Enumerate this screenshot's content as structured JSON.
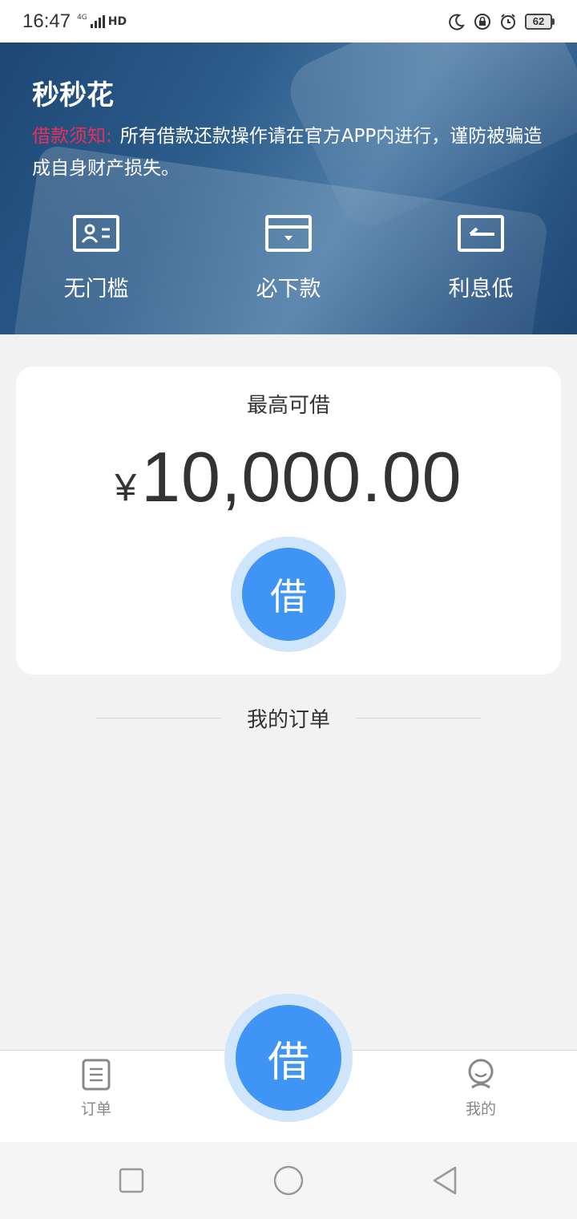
{
  "status_bar": {
    "time": "16:47",
    "network": "4G",
    "hd": "HD",
    "battery": "62"
  },
  "banner": {
    "app_title": "秒秒花",
    "notice_label": "借款须知:",
    "notice_text": "所有借款还款操作请在官方APP内进行，谨防被骗造成自身财产损失。",
    "features": [
      {
        "icon": "id-card-icon",
        "label": "无门槛"
      },
      {
        "icon": "card-drop-icon",
        "label": "必下款"
      },
      {
        "icon": "card-arrow-icon",
        "label": "利息低"
      }
    ]
  },
  "loan_card": {
    "title": "最高可借",
    "currency": "¥",
    "amount": "10,000.00",
    "borrow_label": "借"
  },
  "orders": {
    "heading": "我的订单"
  },
  "tabbar": {
    "orders_label": "订单",
    "center_label": "借",
    "mine_label": "我的"
  },
  "colors": {
    "primary_blue": "#3f94f4",
    "button_halo": "#cfe5fb",
    "notice_red": "#e8305a",
    "banner_blue": "#2c5c8a"
  }
}
